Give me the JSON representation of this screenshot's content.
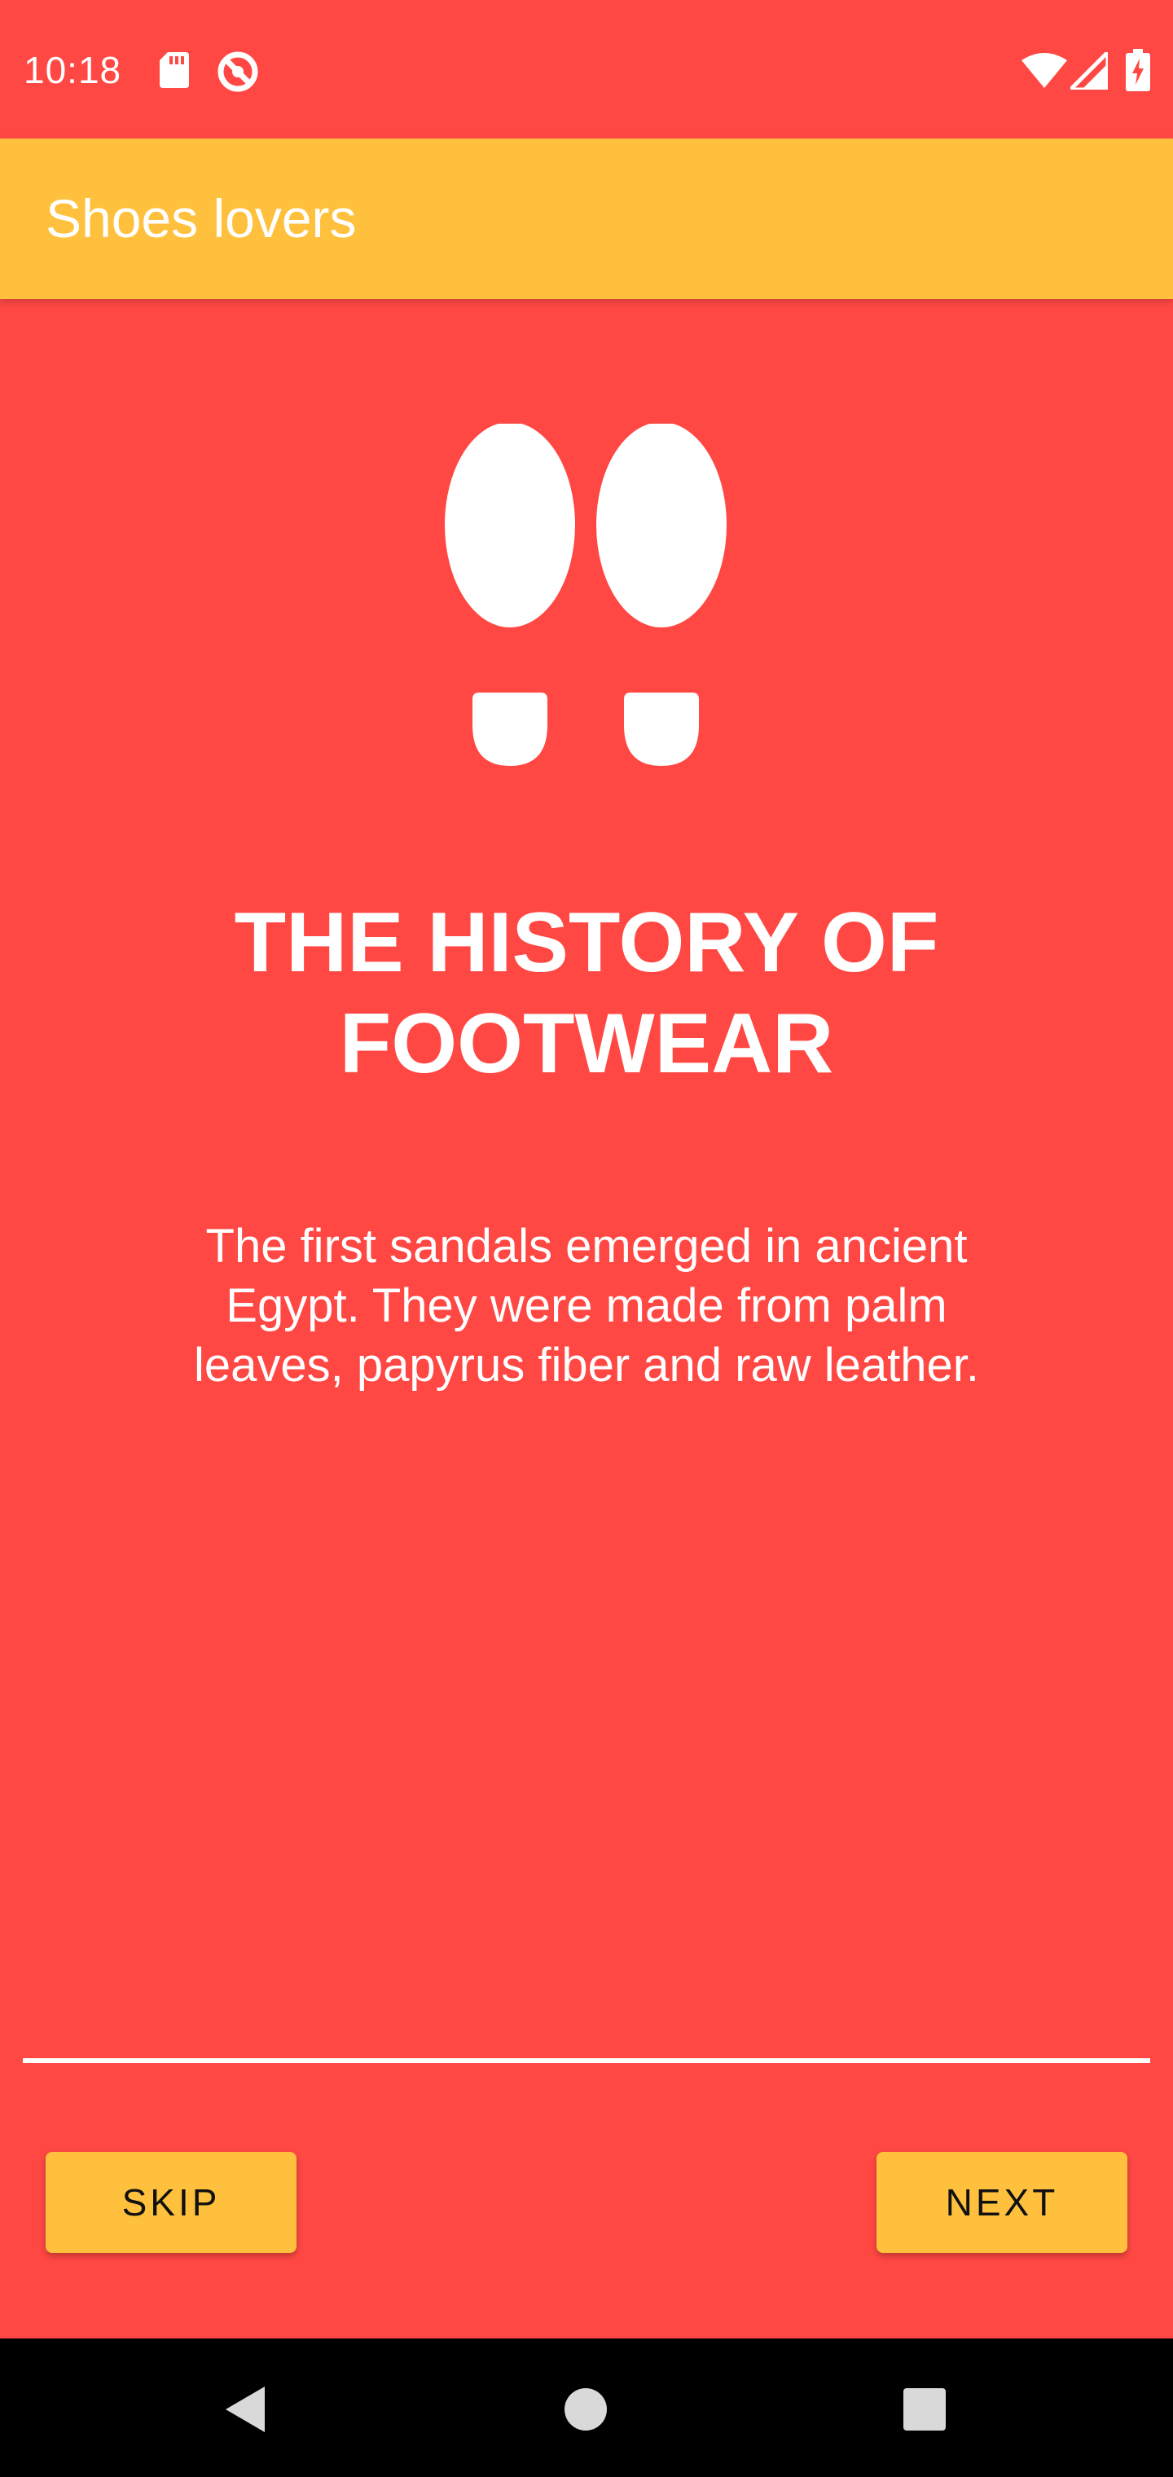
{
  "status_bar": {
    "time": "10:18",
    "icons_left": [
      "sd-card-icon",
      "no-disturb-icon"
    ],
    "icons_right": [
      "wifi-icon",
      "cell-signal-icon",
      "battery-charging-icon"
    ]
  },
  "app_bar": {
    "title": "Shoes lovers"
  },
  "onboarding": {
    "icon": "footprints-icon",
    "headline": "THE HISTORY OF FOOTWEAR",
    "description": "The first sandals emerged in ancient Egypt. They were made from palm leaves, papyrus fiber and raw leather."
  },
  "buttons": {
    "skip_label": "SKIP",
    "next_label": "NEXT"
  },
  "nav_bar": {
    "icons": [
      "back-icon",
      "home-icon",
      "recents-icon"
    ]
  },
  "colors": {
    "background": "#FF4843",
    "accent": "#FFC13D",
    "text": "#FFFFFF",
    "nav": "#000000"
  }
}
